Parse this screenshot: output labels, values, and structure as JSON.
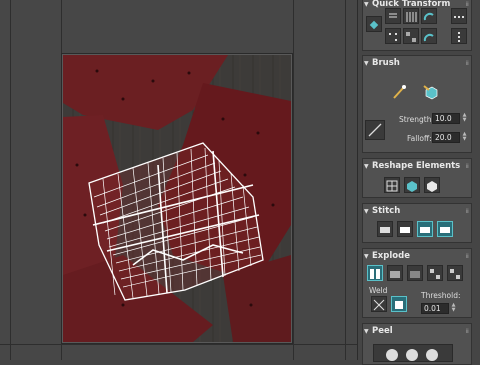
{
  "panel": {
    "quick_transform": {
      "title": "Quick Transform"
    },
    "brush": {
      "title": "Brush",
      "strength_label": "Strength:",
      "strength_value": "10.0",
      "falloff_label": "Falloff:",
      "falloff_value": "20.0"
    },
    "reshape": {
      "title": "Reshape Elements"
    },
    "stitch": {
      "title": "Stitch"
    },
    "explode": {
      "title": "Explode",
      "weld_label": "Weld",
      "threshold_label": "Threshold:",
      "threshold_value": "0.01"
    },
    "peel": {
      "title": "Peel"
    }
  },
  "colors": {
    "accent_cyan": "#5ac1c9",
    "cracker_red": "#6b1f22",
    "uv_mesh": "#ffffff",
    "panel_bg": "#454545"
  }
}
